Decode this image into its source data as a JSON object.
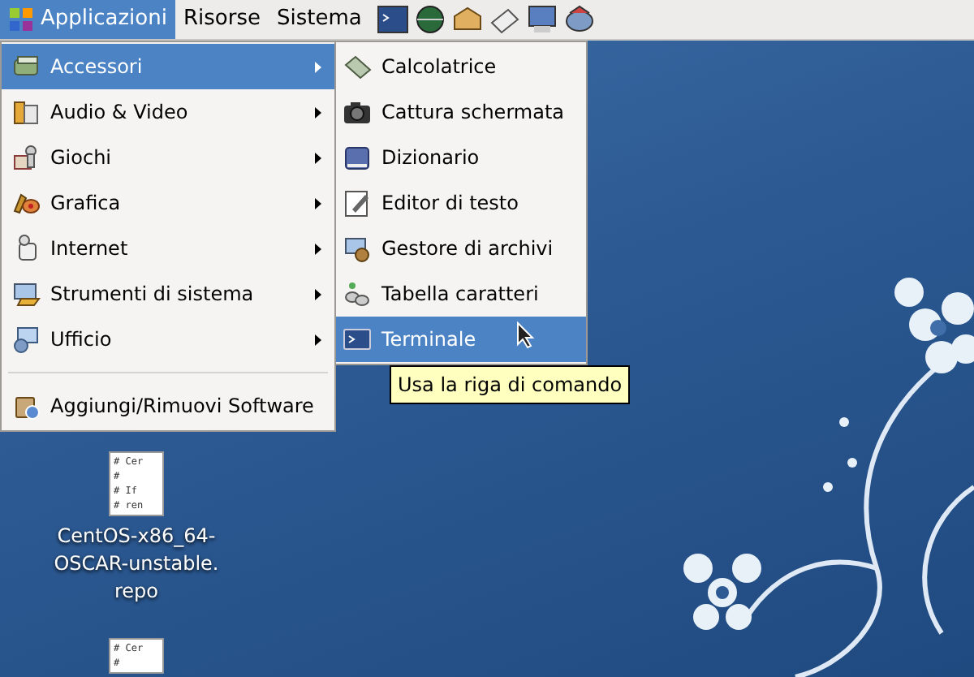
{
  "panel": {
    "menus": [
      {
        "label": "Applicazioni",
        "selected": true
      },
      {
        "label": "Risorse",
        "selected": false
      },
      {
        "label": "Sistema",
        "selected": false
      }
    ]
  },
  "main_menu": {
    "items": [
      {
        "label": "Accessori",
        "submenu": true,
        "selected": true,
        "separator_before": false
      },
      {
        "label": "Audio & Video",
        "submenu": true,
        "selected": false,
        "separator_before": false
      },
      {
        "label": "Giochi",
        "submenu": true,
        "selected": false,
        "separator_before": false
      },
      {
        "label": "Grafica",
        "submenu": true,
        "selected": false,
        "separator_before": false
      },
      {
        "label": "Internet",
        "submenu": true,
        "selected": false,
        "separator_before": false
      },
      {
        "label": "Strumenti di sistema",
        "submenu": true,
        "selected": false,
        "separator_before": false
      },
      {
        "label": "Ufficio",
        "submenu": true,
        "selected": false,
        "separator_before": false
      },
      {
        "label": "Aggiungi/Rimuovi Software",
        "submenu": false,
        "selected": false,
        "separator_before": true
      }
    ]
  },
  "submenu": {
    "items": [
      {
        "label": "Calcolatrice",
        "selected": false
      },
      {
        "label": "Cattura schermata",
        "selected": false
      },
      {
        "label": "Dizionario",
        "selected": false
      },
      {
        "label": "Editor di testo",
        "selected": false
      },
      {
        "label": "Gestore di archivi",
        "selected": false
      },
      {
        "label": "Tabella caratteri",
        "selected": false
      },
      {
        "label": "Terminale",
        "selected": true
      }
    ]
  },
  "tooltip": "Usa la riga di comando",
  "desktop_icons": [
    {
      "preview_lines": [
        "# Cer",
        "#",
        "# If",
        "# ren"
      ],
      "label_lines": [
        "CentOS-x86_64-",
        "OSCAR-unstable.",
        "repo"
      ]
    },
    {
      "preview_lines": [
        "# Cer",
        "#"
      ]
    }
  ]
}
